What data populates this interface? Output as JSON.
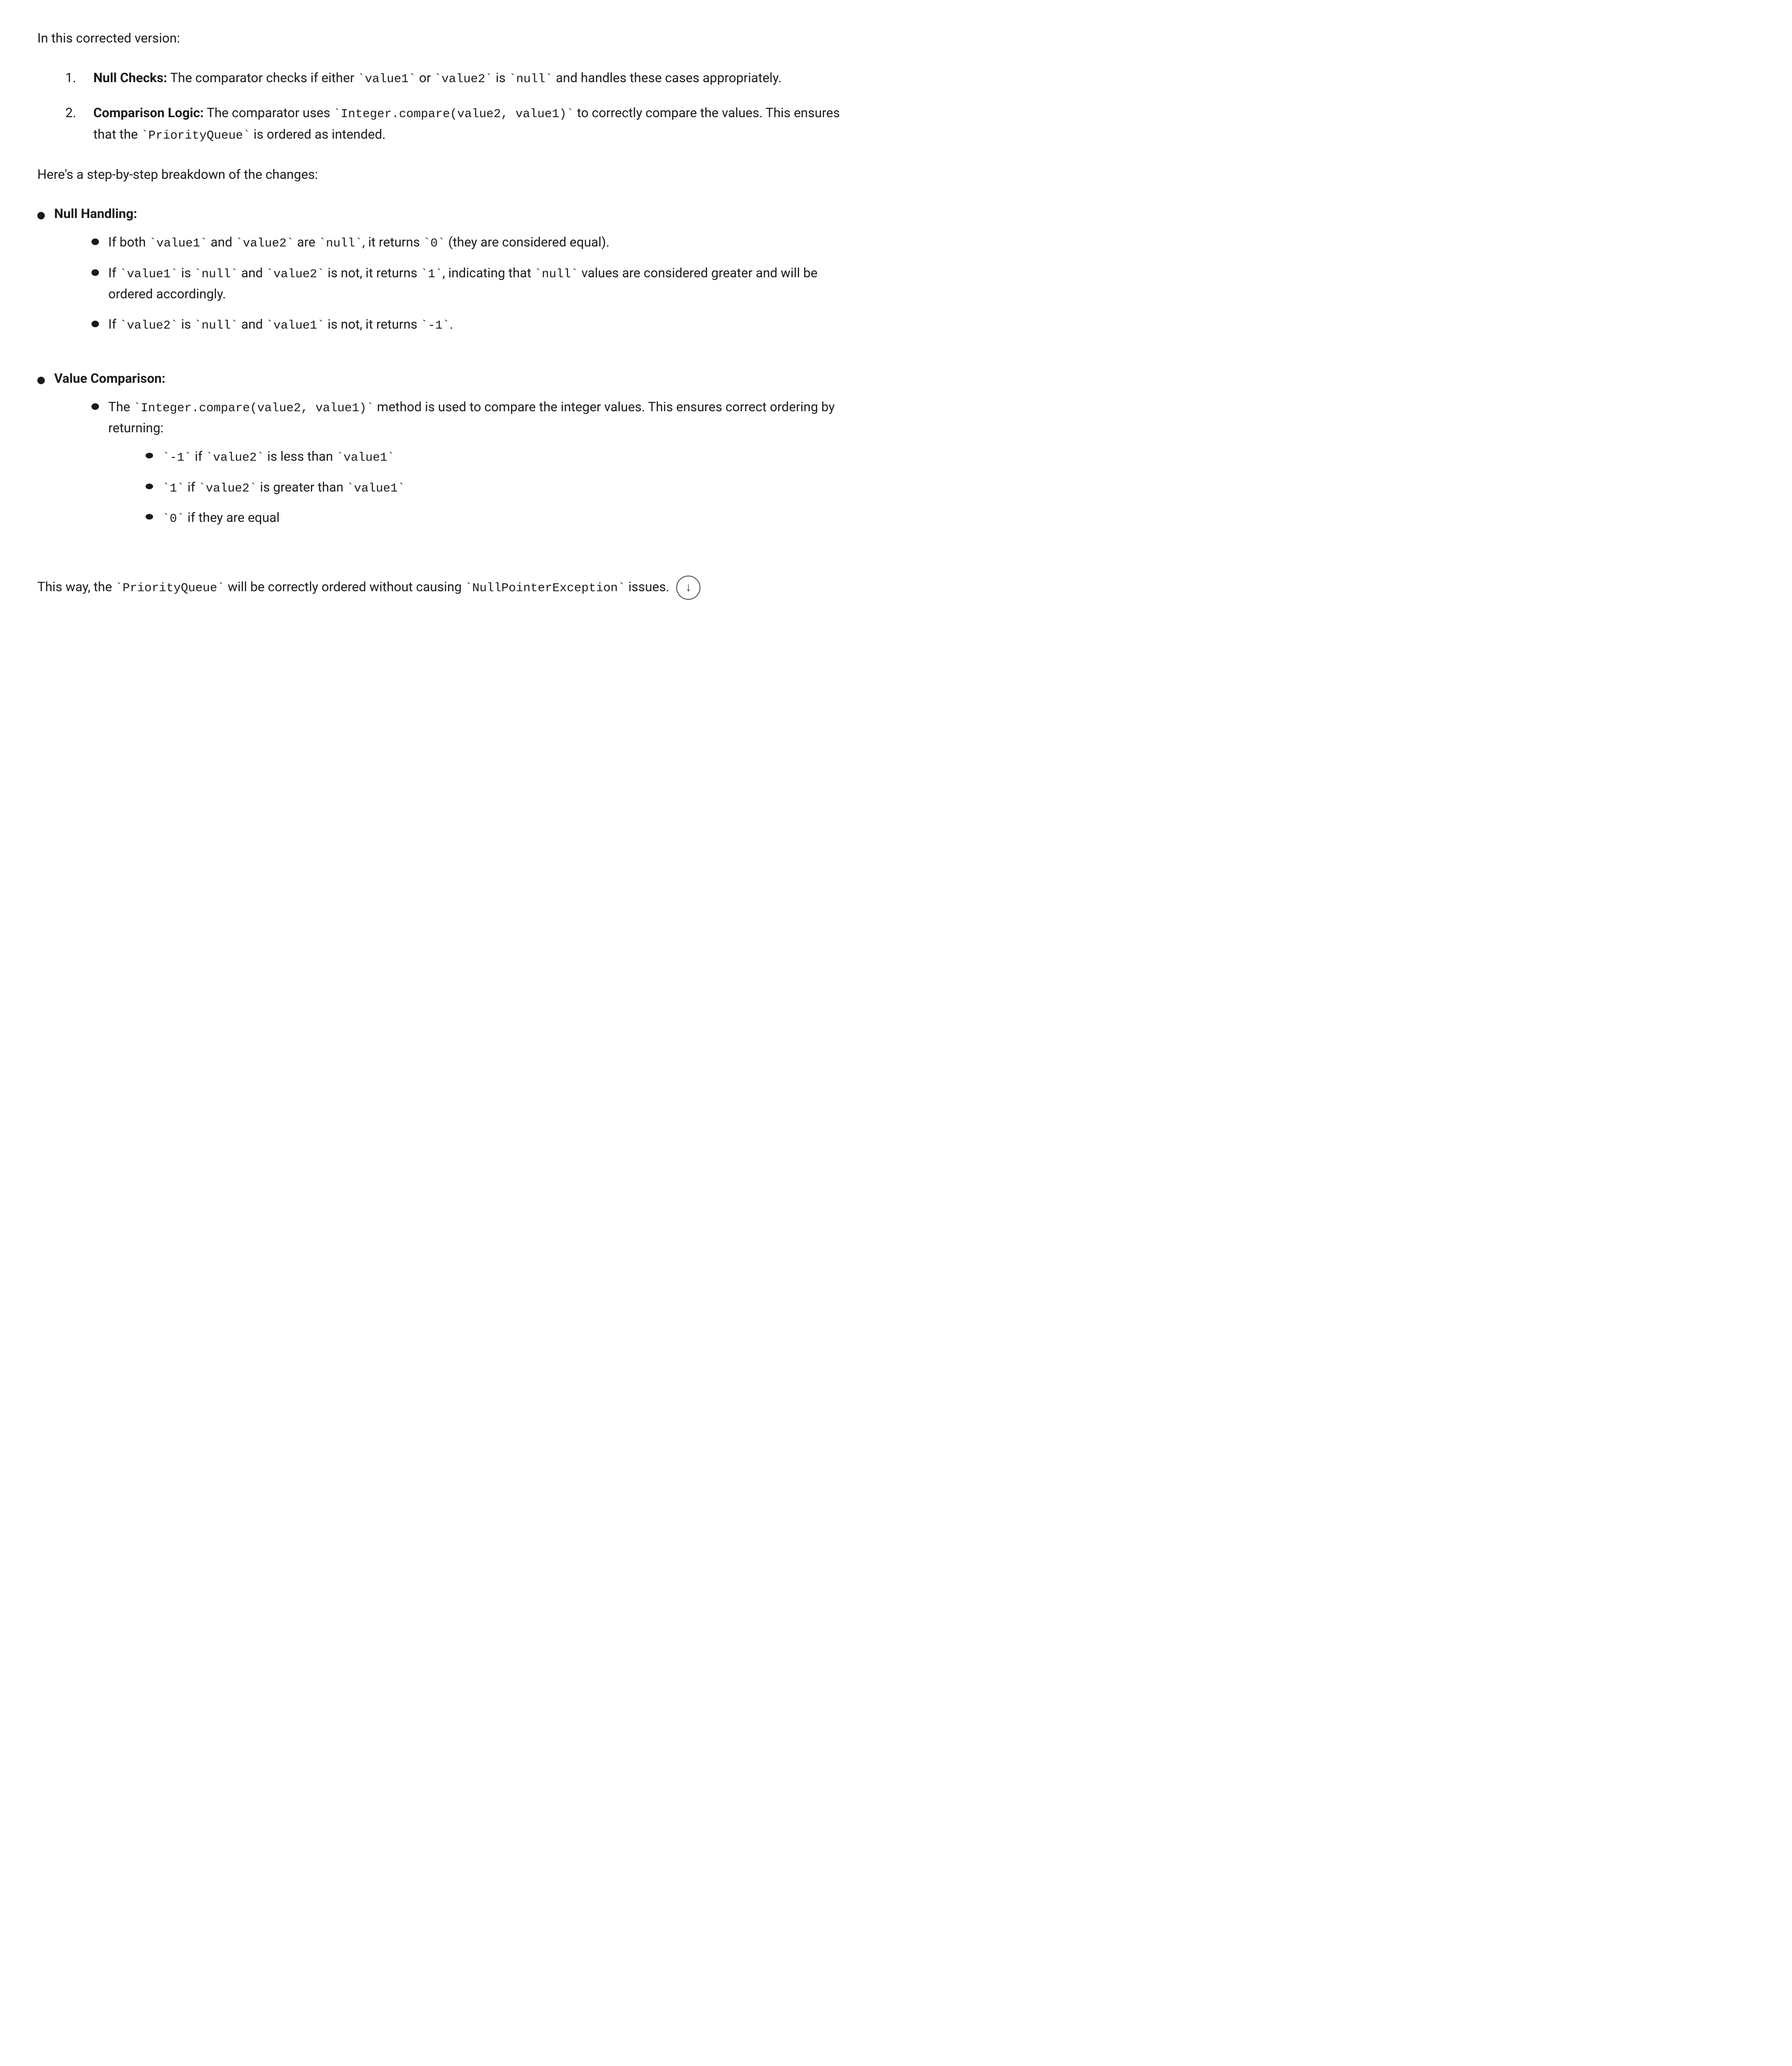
{
  "intro": {
    "text": "In this corrected version:"
  },
  "numbered_items": [
    {
      "num": "1.",
      "label": "Null Checks:",
      "text_parts": [
        " The comparator checks if either ",
        "value1",
        " or ",
        "value2",
        " is ",
        "null",
        " and handles these cases appropriately."
      ]
    },
    {
      "num": "2.",
      "label": "Comparison Logic:",
      "text_parts": [
        " The comparator uses ",
        "Integer.compare(value2, value1)",
        " to correctly compare the values. This ensures that the ",
        "PriorityQueue",
        " is ordered as intended."
      ]
    }
  ],
  "step_intro": "Here's a step-by-step breakdown of the changes:",
  "sections": [
    {
      "label": "Null Handling:",
      "nested": [
        {
          "text_parts": [
            "If both ",
            "value1",
            " and ",
            "value2",
            " are ",
            "null",
            ", it returns ",
            "0",
            " (they are considered equal)."
          ]
        },
        {
          "text_parts": [
            "If ",
            "value1",
            " is ",
            "null",
            " and ",
            "value2",
            " is not, it returns ",
            "1",
            ", indicating that ",
            "null",
            " values are considered greater and will be ordered accordingly."
          ]
        },
        {
          "text_parts": [
            "If ",
            "value2",
            " is ",
            "null",
            " and ",
            "value1",
            " is not, it returns ",
            "-1",
            "."
          ]
        }
      ]
    },
    {
      "label": "Value Comparison:",
      "nested": [
        {
          "text_parts": [
            "The ",
            "Integer.compare(value2, value1)",
            " method is used to compare the integer values. This ensures correct ordering by returning:"
          ],
          "deep": [
            {
              "text_parts": [
                "-1",
                " if ",
                "value2",
                " is less than ",
                "value1"
              ]
            },
            {
              "text_parts": [
                "1",
                " if ",
                "value2",
                " is greater than ",
                "value1"
              ]
            },
            {
              "text_parts": [
                "0",
                " if they are equal"
              ]
            }
          ]
        }
      ]
    }
  ],
  "final_text_parts": [
    "This way, the ",
    "PriorityQueue",
    " will be correctly ordered without causing ",
    "NullPointerException",
    " issues."
  ],
  "scroll_icon": "↓"
}
